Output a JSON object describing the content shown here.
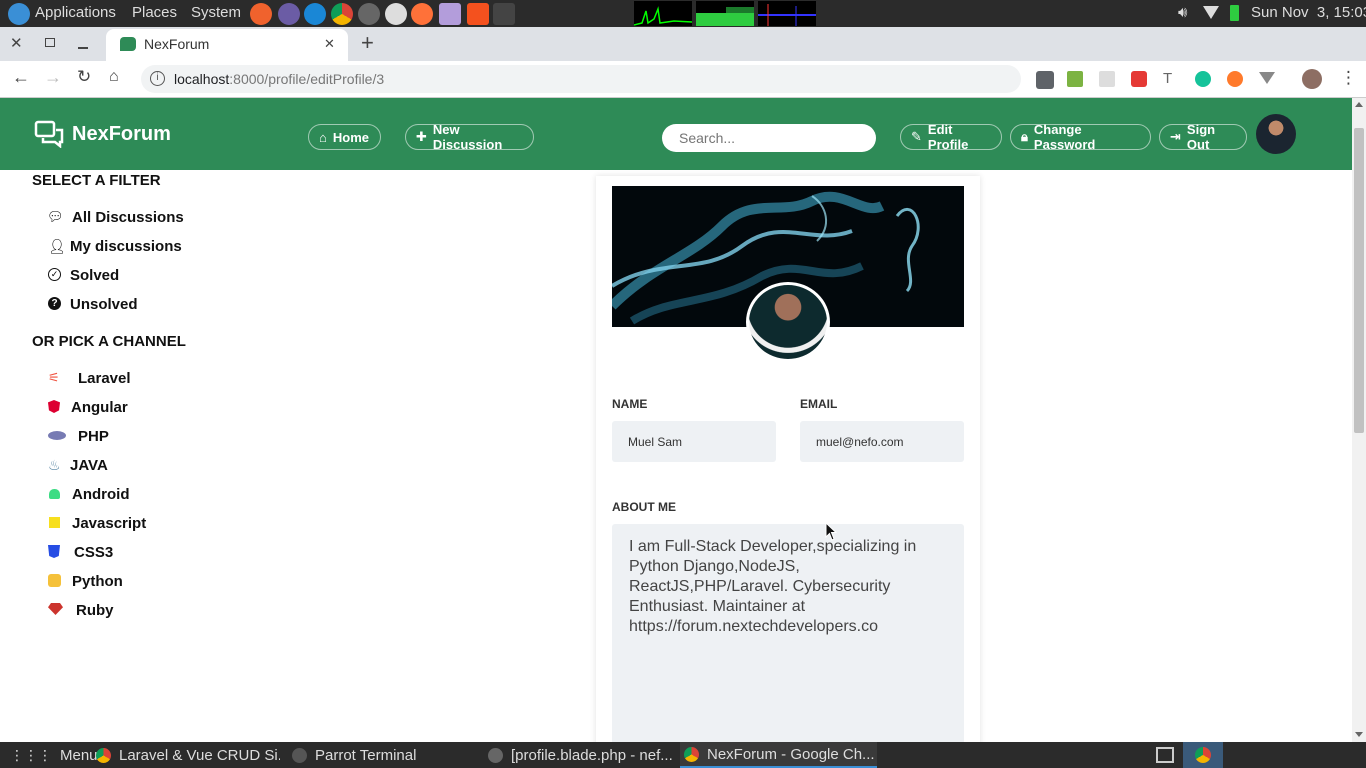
{
  "os_panel": {
    "menus": [
      "Applications",
      "Places",
      "System"
    ],
    "clock": "Sun Nov  3, 15:03"
  },
  "browser": {
    "tab_title": "NexForum",
    "url_host": "localhost",
    "url_rest": ":8000/profile/editProfile/3"
  },
  "site": {
    "brand": "NexForum",
    "nav": {
      "home": "Home",
      "new_discussion": "New Discussion",
      "search_placeholder": "Search...",
      "edit_profile": "Edit Profile",
      "change_password": "Change Password",
      "sign_out": "Sign Out"
    },
    "filters": {
      "heading": "SELECT A FILTER",
      "items": [
        "All Discussions",
        "My discussions",
        "Solved",
        "Unsolved"
      ]
    },
    "channels": {
      "heading": "OR PICK A CHANNEL",
      "items": [
        "Laravel",
        "Angular",
        "PHP",
        "JAVA",
        "Android",
        "Javascript",
        "CSS3",
        "Python",
        "Ruby"
      ]
    },
    "profile_form": {
      "name_label": "NAME",
      "name_value": "Muel Sam",
      "email_label": "EMAIL",
      "email_value": "muel@nefo.com",
      "about_label": "ABOUT ME",
      "about_value": "I am Full-Stack Developer,specializing in Python Django,NodeJS, ReactJS,PHP/Laravel. Cybersecurity Enthusiast. Maintainer at https://forum.nextechdevelopers.co"
    }
  },
  "taskbar": {
    "menu": "Menu",
    "windows": [
      "Laravel & Vue CRUD Si...",
      "Parrot Terminal",
      "[profile.blade.php - nef...",
      "NexForum - Google Ch..."
    ]
  },
  "colors": {
    "brand_green": "#2e8b57",
    "os_panel": "#2b2b2b",
    "input_bg": "#eef1f4"
  }
}
